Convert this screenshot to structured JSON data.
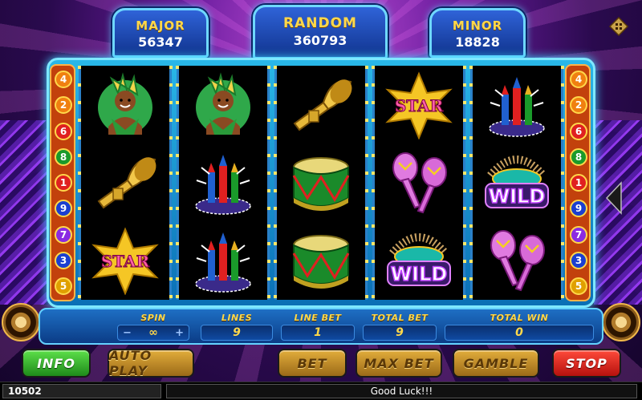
{
  "jackpots": {
    "major": {
      "label": "MAJOR",
      "value": "56347"
    },
    "random": {
      "label": "RANDOM",
      "value": "360793"
    },
    "minor": {
      "label": "MINOR",
      "value": "18828"
    }
  },
  "paylines": {
    "left": [
      "4",
      "2",
      "6",
      "8",
      "1",
      "9",
      "7",
      "3",
      "5"
    ],
    "right": [
      "4",
      "2",
      "6",
      "8",
      "1",
      "9",
      "7",
      "3",
      "5"
    ]
  },
  "reels": [
    [
      "dancer",
      "trumpet",
      "star"
    ],
    [
      "dancer",
      "fireworks",
      "fireworks"
    ],
    [
      "trumpet",
      "drum",
      "drum"
    ],
    [
      "star",
      "maracas",
      "wild"
    ],
    [
      "fireworks",
      "wild",
      "maracas"
    ]
  ],
  "symbol_text": {
    "star": "STAR",
    "wild": "WILD"
  },
  "controls": {
    "spin": {
      "label": "SPIN",
      "value": "∞",
      "minus": "−",
      "plus": "+"
    },
    "lines": {
      "label": "LINES",
      "value": "9"
    },
    "line_bet": {
      "label": "LINE BET",
      "value": "1"
    },
    "total_bet": {
      "label": "TOTAL BET",
      "value": "9"
    },
    "total_win": {
      "label": "TOTAL WIN",
      "value": "0"
    }
  },
  "buttons": {
    "info": "INFO",
    "auto_play": "AUTO PLAY",
    "bet": "BET",
    "max_bet": "MAX BET",
    "gamble": "GAMBLE",
    "stop": "STOP"
  },
  "status": {
    "credit": "10502",
    "message": "Good Luck!!!"
  },
  "icons": {
    "menu": "menu-icon",
    "side_arrow": "arrow-left-icon"
  },
  "colors": {
    "frame": "#29b7e8",
    "jackpot_label": "#ffd84a",
    "stop": "#e02020",
    "info": "#3cc22c"
  }
}
